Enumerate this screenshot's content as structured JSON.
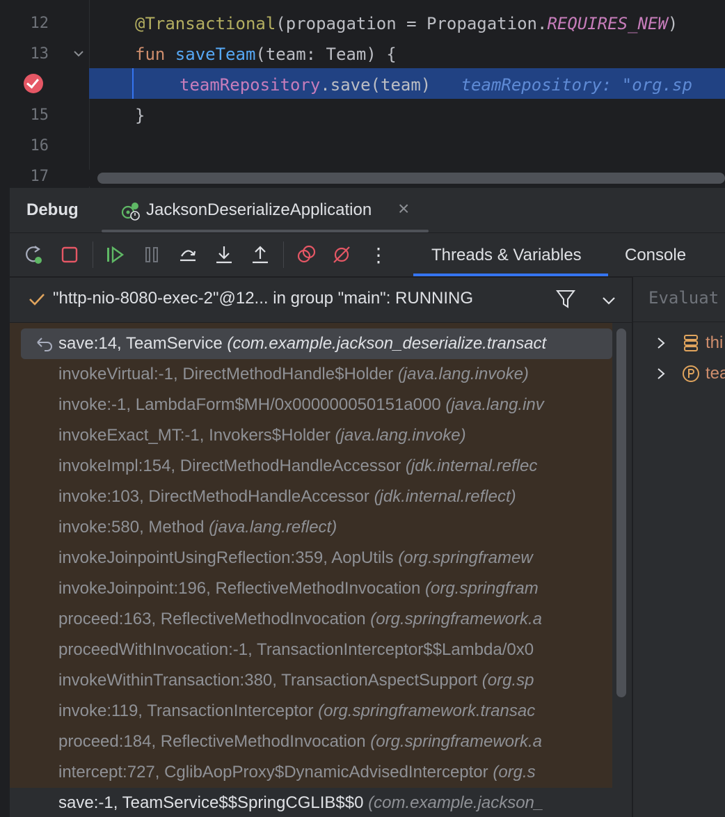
{
  "editor": {
    "lines": [
      {
        "number": "12"
      },
      {
        "number": "13"
      },
      {
        "number": ""
      },
      {
        "number": "15"
      },
      {
        "number": "16"
      },
      {
        "number": "17"
      }
    ],
    "code": {
      "l12_annotation": "@Transactional",
      "l12_args": "(propagation = Propagation.",
      "l12_const": "REQUIRES_NEW",
      "l12_close": ")",
      "l13_kw": "fun ",
      "l13_name": "saveTeam",
      "l13_rest": "(team: Team) {",
      "l14_prop": "teamRepository",
      "l14_rest": ".save(team)",
      "l14_inline": "teamRepository: \"org.sp",
      "l15": "}"
    }
  },
  "debug": {
    "title": "Debug",
    "session_label": "JacksonDeserializeApplication",
    "close_glyph": "×",
    "view_tabs": [
      "Threads & Variables",
      "Console"
    ],
    "more_glyph": "⋮"
  },
  "thread": {
    "label": "\"http-nio-8080-exec-2\"@12... in group \"main\": RUNNING"
  },
  "frames": [
    {
      "method": "save:14, TeamService ",
      "pkg": "(com.example.jackson_deserialize.transact"
    },
    {
      "method": "invokeVirtual:-1, DirectMethodHandle$Holder ",
      "pkg": "(java.lang.invoke)"
    },
    {
      "method": "invoke:-1, LambdaForm$MH/0x000000050151a000 ",
      "pkg": "(java.lang.inv"
    },
    {
      "method": "invokeExact_MT:-1, Invokers$Holder ",
      "pkg": "(java.lang.invoke)"
    },
    {
      "method": "invokeImpl:154, DirectMethodHandleAccessor ",
      "pkg": "(jdk.internal.reflec"
    },
    {
      "method": "invoke:103, DirectMethodHandleAccessor ",
      "pkg": "(jdk.internal.reflect)"
    },
    {
      "method": "invoke:580, Method ",
      "pkg": "(java.lang.reflect)"
    },
    {
      "method": "invokeJoinpointUsingReflection:359, AopUtils ",
      "pkg": "(org.springframew"
    },
    {
      "method": "invokeJoinpoint:196, ReflectiveMethodInvocation ",
      "pkg": "(org.springfram"
    },
    {
      "method": "proceed:163, ReflectiveMethodInvocation ",
      "pkg": "(org.springframework.a"
    },
    {
      "method": "proceedWithInvocation:-1, TransactionInterceptor$$Lambda/0x0",
      "pkg": ""
    },
    {
      "method": "invokeWithinTransaction:380, TransactionAspectSupport ",
      "pkg": "(org.sp"
    },
    {
      "method": "invoke:119, TransactionInterceptor ",
      "pkg": "(org.springframework.transac"
    },
    {
      "method": "proceed:184, ReflectiveMethodInvocation ",
      "pkg": "(org.springframework.a"
    },
    {
      "method": "intercept:727, CglibAopProxy$DynamicAdvisedInterceptor ",
      "pkg": "(org.s"
    },
    {
      "method": "save:-1, TeamService$$SpringCGLIB$$0 ",
      "pkg": "(com.example.jackson_"
    }
  ],
  "variables": {
    "eval_placeholder": "Evaluat",
    "items": [
      {
        "name": "thi",
        "icon": "field-list-icon"
      },
      {
        "name": "tea",
        "icon": "parameter-icon"
      }
    ]
  },
  "colors": {
    "editor_bg": "#1e1f22",
    "panel_bg": "#2b2d30",
    "exec_line": "#214283",
    "library_frames_bg": "#3a2f25",
    "breakpoint": "#e55765",
    "accent": "#3574f0"
  }
}
